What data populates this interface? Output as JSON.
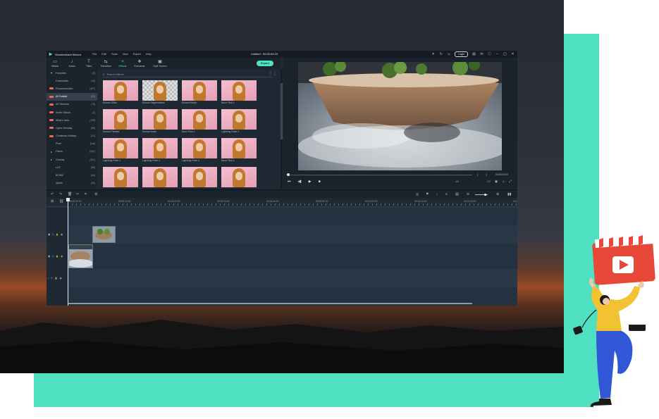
{
  "app": {
    "name": "Wondershare filmora",
    "menu": [
      "File",
      "Edit",
      "Tools",
      "View",
      "Export",
      "Help"
    ],
    "doc_title": "Untitled : 00:00:00:15",
    "login_label": "Login",
    "export_label": "Export"
  },
  "toolbar": {
    "tabs": [
      {
        "label": "Media",
        "icon": "folder-icon"
      },
      {
        "label": "Audio",
        "icon": "music-note-icon"
      },
      {
        "label": "Titles",
        "icon": "title-icon"
      },
      {
        "label": "Transition",
        "icon": "transition-icon"
      },
      {
        "label": "Effects",
        "icon": "effects-icon",
        "active": true
      },
      {
        "label": "Elements",
        "icon": "elements-icon"
      },
      {
        "label": "Split Screen",
        "icon": "split-screen-icon"
      }
    ]
  },
  "sidebar": {
    "items": [
      {
        "label": "Favorites",
        "count": "[0]",
        "mark": "♥"
      },
      {
        "label": "Downloads",
        "count": "[18]"
      },
      {
        "label": "Recommended",
        "count": "[167]",
        "tag": "#e8655a"
      },
      {
        "label": "AI Portrait",
        "count": "[32]",
        "tag": "#e8655a",
        "selected": true
      },
      {
        "label": "AR Stickers",
        "count": "[76]",
        "tag": "#e8655a"
      },
      {
        "label": "Audio Effects",
        "count": "[2]",
        "tag": "#e8655a"
      },
      {
        "label": "What's New",
        "count": "[195]",
        "tag": "#e8655a"
      },
      {
        "label": "Cyber Monday",
        "count": "[56]",
        "tag": "#e8655a"
      },
      {
        "label": "Christmas Holiday",
        "count": "[24]",
        "tag": "#e8655a"
      },
      {
        "label": "Pixel",
        "count": "[116]"
      },
      {
        "label": "Filters",
        "count": "[332]",
        "mark": "▸"
      },
      {
        "label": "Overlay",
        "count": "[331]",
        "mark": "▸"
      },
      {
        "label": "LUT",
        "count": "[89]"
      },
      {
        "label": "BCBW",
        "count": "[46]"
      },
      {
        "label": "Spells",
        "count": "[30]"
      }
    ]
  },
  "effects": {
    "search_placeholder": "Search effects",
    "items": [
      {
        "label": "Human Glitch"
      },
      {
        "label": "Human Segmentation",
        "checker": true
      },
      {
        "label": "Human Border"
      },
      {
        "label": "Neon Flow 1"
      },
      {
        "label": "Human Pixelate"
      },
      {
        "label": "Human Noise"
      },
      {
        "label": "Neon Flow 2"
      },
      {
        "label": "Lightning Flash 4"
      },
      {
        "label": "Lightning Flash 1"
      },
      {
        "label": "Lightning Flash 2"
      },
      {
        "label": "Lightning Flash 3"
      },
      {
        "label": "Neon Flow 4"
      },
      {
        "label": ""
      },
      {
        "label": ""
      },
      {
        "label": ""
      },
      {
        "label": ""
      }
    ]
  },
  "player": {
    "timecode": "00:00:00:00",
    "zoom": "1/2",
    "progress": 0.0
  },
  "timeline": {
    "ruler": [
      "00:00:00:00",
      "00:00:10:00",
      "00:00:20:00",
      "00:00:30:00",
      "00:00:40:00",
      "00:00:50:00",
      "00:01:00:00",
      "00:01:10:00",
      "00:01:20:00",
      "00:01:30:00"
    ],
    "tracks": [
      {
        "label": "1"
      },
      {
        "label": "1"
      },
      {
        "label": "1"
      }
    ]
  },
  "colors": {
    "accent": "#4fe3c6",
    "teal_frame": "#4ee0c1",
    "play_badge": "#e8483a"
  }
}
